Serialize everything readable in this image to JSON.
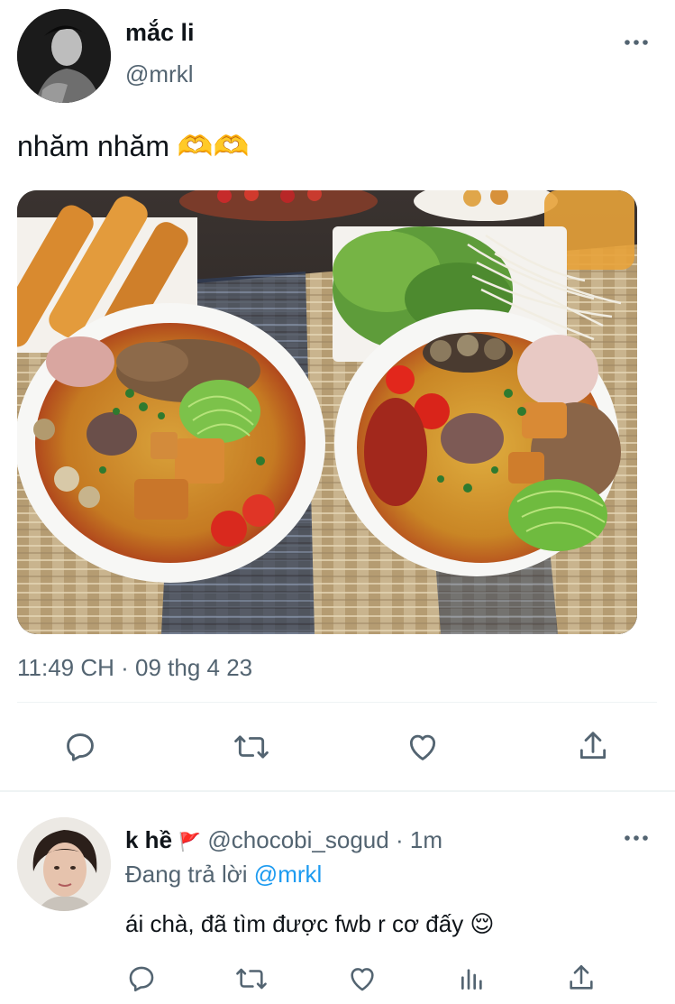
{
  "tweet": {
    "author_name": "mắc li",
    "author_handle": "@mrkl",
    "text": "nhăm nhăm 🫶🫶",
    "timestamp": "11:49 CH · 09 thg 4 23",
    "image_alt": "Two bowls of bún riêu with crab paste, tofu, tomatoes, snails, herbs and fried dough sticks"
  },
  "reply": {
    "author_name": "k hề",
    "author_flag": "🚩",
    "author_handle": "@chocobi_sogud",
    "separator": "·",
    "age": "1m",
    "replying_prefix": "Đang trả lời",
    "replying_to": "@mrkl",
    "text": "ái chà, đã tìm được fwb r cơ đấy 😌"
  },
  "colors": {
    "text": "#0f1419",
    "muted": "#536471",
    "link": "#1d9bf0",
    "divider": "#eff3f4"
  },
  "icons": {
    "reply": "speech-bubble-icon",
    "retweet": "retweet-arrows-icon",
    "like": "heart-icon",
    "share": "share-upload-icon",
    "views": "bar-chart-icon",
    "more": "more-dots-icon"
  }
}
